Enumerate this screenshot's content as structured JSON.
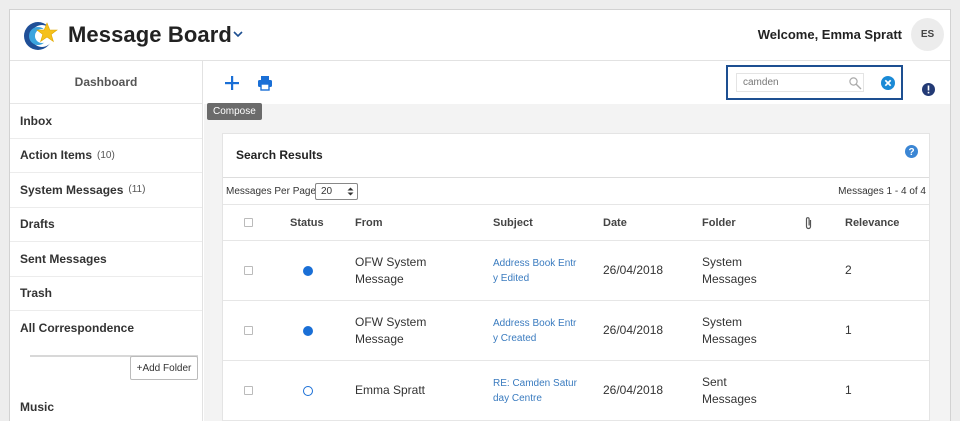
{
  "header": {
    "title": "Message Board",
    "welcome": "Welcome, Emma Spratt",
    "avatar_initials": "ES"
  },
  "sidebar": {
    "dashboard": "Dashboard",
    "items": [
      {
        "label": "Inbox",
        "count": ""
      },
      {
        "label": "Action Items",
        "count": "(10)"
      },
      {
        "label": "System Messages",
        "count": "(11)"
      },
      {
        "label": "Drafts",
        "count": ""
      },
      {
        "label": "Sent Messages",
        "count": ""
      },
      {
        "label": "Trash",
        "count": ""
      },
      {
        "label": "All Correspondence",
        "count": ""
      }
    ],
    "add_folder": "+Add Folder",
    "music": "Music"
  },
  "toolbar": {
    "compose_tooltip": "Compose",
    "search_value": "camden"
  },
  "results": {
    "title": "Search Results",
    "per_page_label": "Messages Per Page",
    "per_page_value": "20",
    "count": "Messages 1 - 4 of 4",
    "columns": {
      "status": "Status",
      "from": "From",
      "subject": "Subject",
      "date": "Date",
      "folder": "Folder",
      "relevance": "Relevance"
    },
    "rows": [
      {
        "status": "unread",
        "from_1": "OFW System",
        "from_2": "Message",
        "subj_1": "Address Book Entr",
        "subj_2": "y Edited",
        "date": "26/04/2018",
        "folder_1": "System",
        "folder_2": "Messages",
        "relevance": "2"
      },
      {
        "status": "unread",
        "from_1": "OFW System",
        "from_2": "Message",
        "subj_1": "Address Book Entr",
        "subj_2": "y Created",
        "date": "26/04/2018",
        "folder_1": "System",
        "folder_2": "Messages",
        "relevance": "1"
      },
      {
        "status": "read",
        "from_1": "Emma Spratt",
        "from_2": "",
        "subj_1": "RE: Camden Satur",
        "subj_2": "day Centre",
        "date": "26/04/2018",
        "folder_1": "Sent",
        "folder_2": "Messages",
        "relevance": "1"
      }
    ]
  },
  "colors": {
    "accent": "#1a6fd6",
    "link": "#3a7bbf",
    "search_border": "#1d4f91"
  }
}
